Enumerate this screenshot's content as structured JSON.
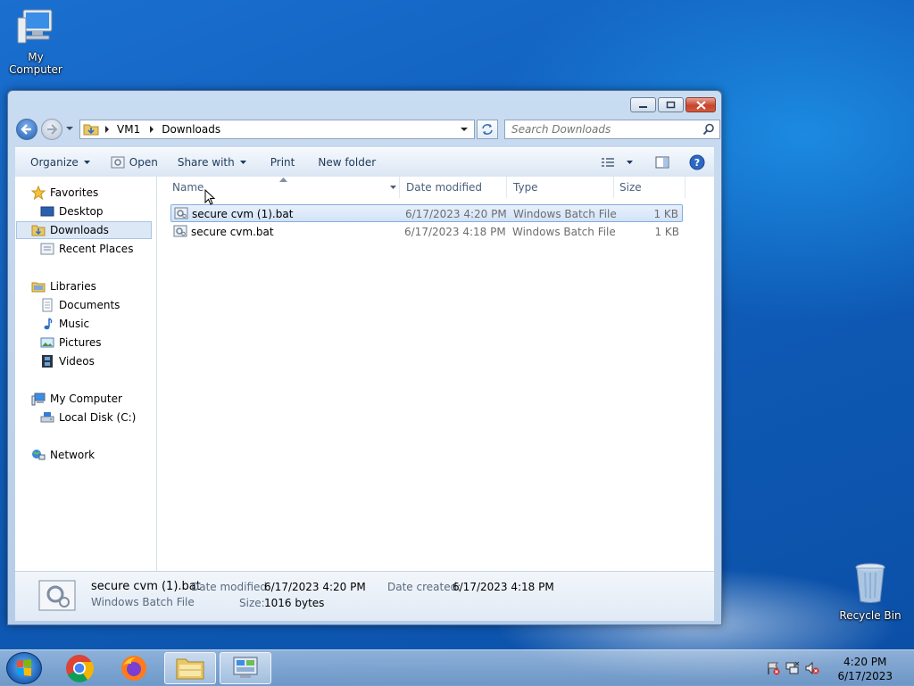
{
  "desktop": {
    "my_computer_label": "My Computer",
    "recycle_bin_label": "Recycle Bin"
  },
  "window": {
    "breadcrumb": [
      "VM1",
      "Downloads"
    ],
    "search_placeholder": "Search Downloads",
    "toolbar": {
      "organize": "Organize",
      "open": "Open",
      "share_with": "Share with",
      "print": "Print",
      "new_folder": "New folder"
    },
    "nav": {
      "favorites": "Favorites",
      "desktop": "Desktop",
      "downloads": "Downloads",
      "recent_places": "Recent Places",
      "libraries": "Libraries",
      "documents": "Documents",
      "music": "Music",
      "pictures": "Pictures",
      "videos": "Videos",
      "my_computer": "My Computer",
      "local_disk": "Local Disk (C:)",
      "network": "Network"
    },
    "columns": {
      "name": "Name",
      "date_modified": "Date modified",
      "type": "Type",
      "size": "Size"
    },
    "files": [
      {
        "name": "secure cvm (1).bat",
        "date": "6/17/2023 4:20 PM",
        "type": "Windows Batch File",
        "size": "1 KB",
        "selected": true
      },
      {
        "name": "secure cvm.bat",
        "date": "6/17/2023 4:18 PM",
        "type": "Windows Batch File",
        "size": "1 KB",
        "selected": false
      }
    ],
    "details": {
      "filename": "secure cvm (1).bat",
      "filetype": "Windows Batch File",
      "date_modified_label": "Date modified:",
      "date_modified": "6/17/2023 4:20 PM",
      "size_label": "Size:",
      "size": "1016 bytes",
      "date_created_label": "Date created:",
      "date_created": "6/17/2023 4:18 PM"
    }
  },
  "taskbar": {
    "time": "4:20 PM",
    "date": "6/17/2023"
  },
  "colors": {
    "desktop_blue": "#1565c0",
    "selection_fill": "#d2e3f8",
    "selection_border": "#84acdd",
    "toolbar_text": "#1e395b"
  }
}
